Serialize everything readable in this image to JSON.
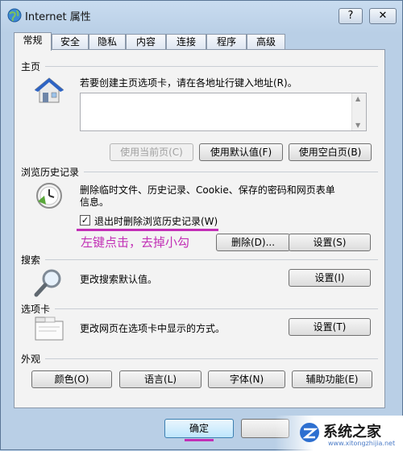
{
  "window": {
    "title": "Internet 属性",
    "help_label": "?",
    "close_label": "✕"
  },
  "tabs": [
    "常规",
    "安全",
    "隐私",
    "内容",
    "连接",
    "程序",
    "高级"
  ],
  "home": {
    "title": "主页",
    "description": "若要创建主页选项卡，请在各地址行键入地址(R)。",
    "btn_current": "使用当前页(C)",
    "btn_default": "使用默认值(F)",
    "btn_blank": "使用空白页(B)"
  },
  "history": {
    "title": "浏览历史记录",
    "description_line1": "删除临时文件、历史记录、Cookie、保存的密码和网页表单",
    "description_line2": "信息。",
    "checkbox_label": "退出时删除浏览历史记录(W)",
    "checkbox_checked": true,
    "btn_delete": "删除(D)...",
    "btn_settings": "设置(S)",
    "annotation": "左键点击，去掉小勾"
  },
  "search": {
    "title": "搜索",
    "description": "更改搜索默认值。",
    "btn_settings": "设置(I)"
  },
  "tabs_group": {
    "title": "选项卡",
    "description": "更改网页在选项卡中显示的方式。",
    "btn_settings": "设置(T)"
  },
  "appearance": {
    "title": "外观",
    "btn_colors": "颜色(O)",
    "btn_languages": "语言(L)",
    "btn_fonts": "字体(N)",
    "btn_accessibility": "辅助功能(E)"
  },
  "footer": {
    "ok_label": "确定"
  },
  "watermark": {
    "text": "系统之家",
    "sub": "www.xitongzhijia.net"
  },
  "colors": {
    "annotation": "#c22fb6"
  }
}
